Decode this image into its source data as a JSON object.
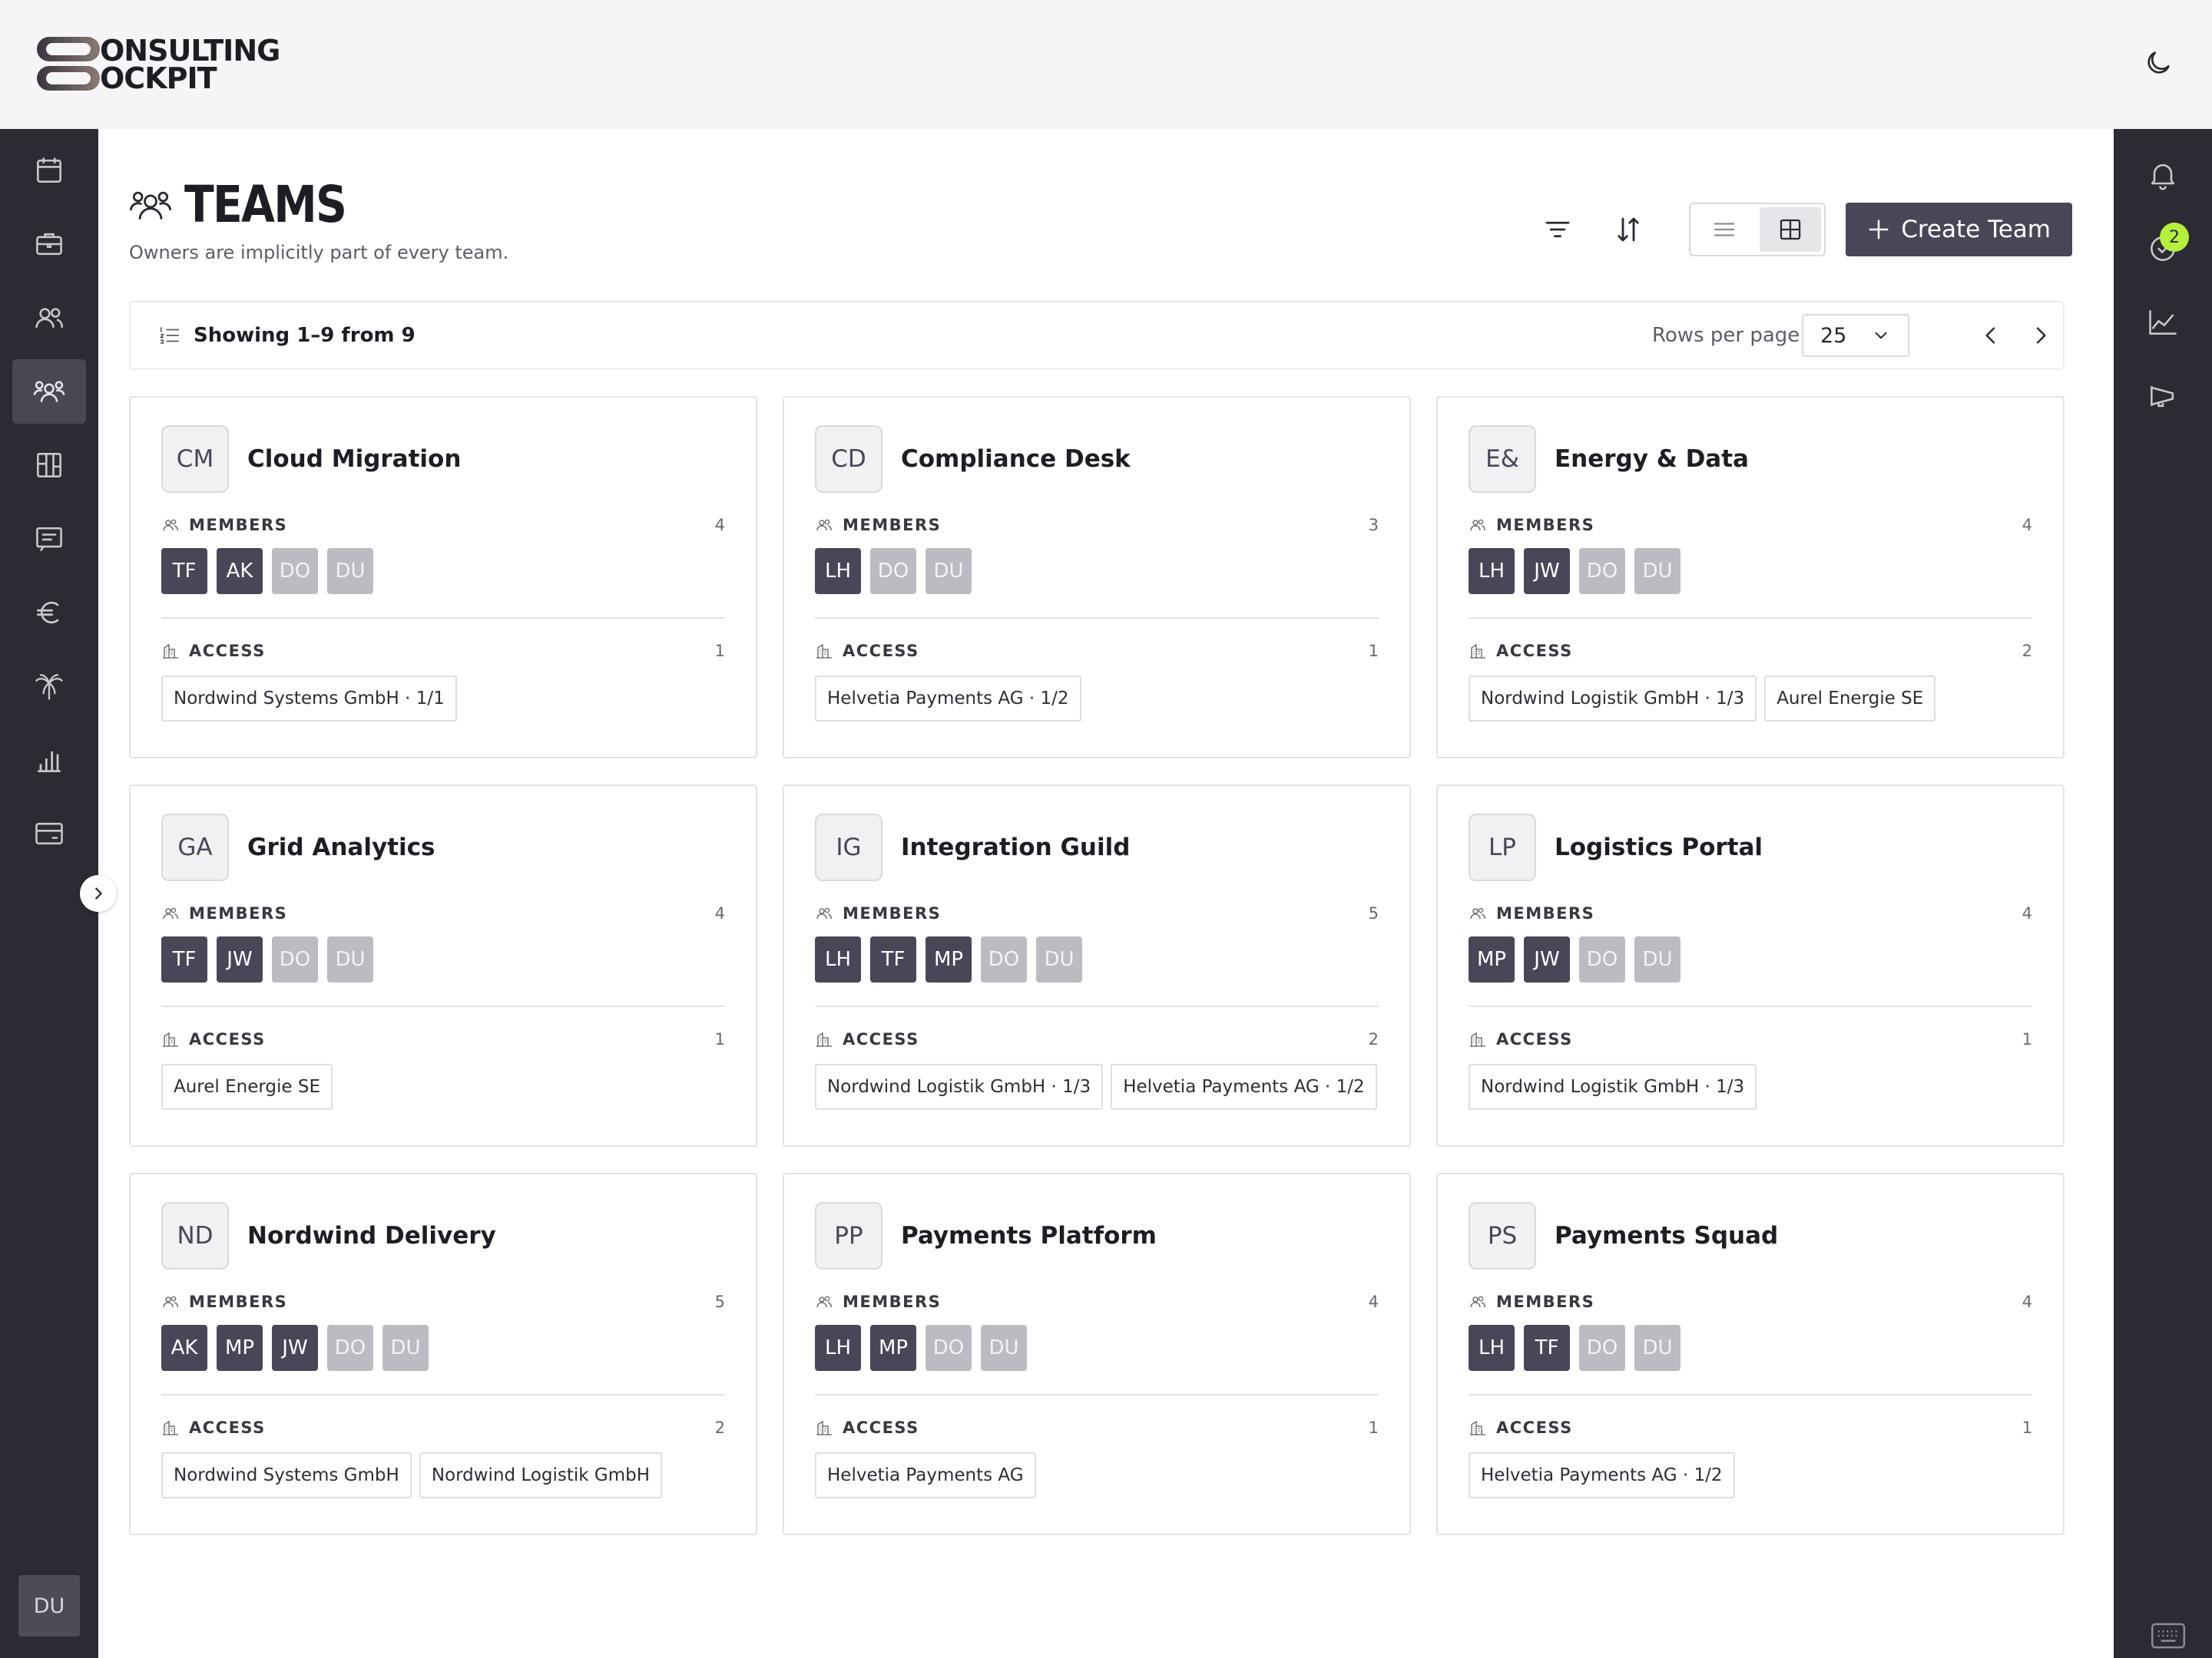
{
  "app": {
    "logo_text_line1": "ONSULTING",
    "logo_text_line2": "OCKPIT"
  },
  "page": {
    "title": "TEAMS",
    "subtitle": "Owners are implicitly part of every team."
  },
  "toolbar": {
    "create_label": "Create Team"
  },
  "pager": {
    "showing": "Showing 1–9 from 9",
    "rows_label": "Rows per page",
    "rows_value": "25"
  },
  "sidebar": {
    "items": [
      {
        "icon": "calendar-icon"
      },
      {
        "icon": "briefcase-icon"
      },
      {
        "icon": "people-icon"
      },
      {
        "icon": "teams-icon",
        "active": true
      },
      {
        "icon": "board-icon"
      },
      {
        "icon": "message-icon"
      },
      {
        "icon": "euro-icon"
      },
      {
        "icon": "palm-icon"
      },
      {
        "icon": "bar-chart-icon"
      },
      {
        "icon": "credit-card-icon"
      }
    ],
    "user_initials": "DU"
  },
  "right_sidebar": {
    "notification_badge": "2"
  },
  "labels": {
    "members": "MEMBERS",
    "access": "ACCESS"
  },
  "colors": {
    "sidebar_bg": "#2c2a32",
    "accent": "#4a4658",
    "badge": "#b4f03c"
  },
  "teams": [
    {
      "initials": "CM",
      "name": "Cloud Migration",
      "member_count": "4",
      "members": [
        {
          "i": "TF",
          "m": false
        },
        {
          "i": "AK",
          "m": false
        },
        {
          "i": "DO",
          "m": true
        },
        {
          "i": "DU",
          "m": true
        }
      ],
      "access_count": "1",
      "access": [
        "Nordwind Systems GmbH · 1/1"
      ]
    },
    {
      "initials": "CD",
      "name": "Compliance Desk",
      "member_count": "3",
      "members": [
        {
          "i": "LH",
          "m": false
        },
        {
          "i": "DO",
          "m": true
        },
        {
          "i": "DU",
          "m": true
        }
      ],
      "access_count": "1",
      "access": [
        "Helvetia Payments AG · 1/2"
      ]
    },
    {
      "initials": "E&",
      "name": "Energy & Data",
      "member_count": "4",
      "members": [
        {
          "i": "LH",
          "m": false
        },
        {
          "i": "JW",
          "m": false
        },
        {
          "i": "DO",
          "m": true
        },
        {
          "i": "DU",
          "m": true
        }
      ],
      "access_count": "2",
      "access": [
        "Nordwind Logistik GmbH · 1/3",
        "Aurel Energie SE"
      ]
    },
    {
      "initials": "GA",
      "name": "Grid Analytics",
      "member_count": "4",
      "members": [
        {
          "i": "TF",
          "m": false
        },
        {
          "i": "JW",
          "m": false
        },
        {
          "i": "DO",
          "m": true
        },
        {
          "i": "DU",
          "m": true
        }
      ],
      "access_count": "1",
      "access": [
        "Aurel Energie SE"
      ]
    },
    {
      "initials": "IG",
      "name": "Integration Guild",
      "member_count": "5",
      "members": [
        {
          "i": "LH",
          "m": false
        },
        {
          "i": "TF",
          "m": false
        },
        {
          "i": "MP",
          "m": false
        },
        {
          "i": "DO",
          "m": true
        },
        {
          "i": "DU",
          "m": true
        }
      ],
      "access_count": "2",
      "access": [
        "Nordwind Logistik GmbH · 1/3",
        "Helvetia Payments AG · 1/2"
      ]
    },
    {
      "initials": "LP",
      "name": "Logistics Portal",
      "member_count": "4",
      "members": [
        {
          "i": "MP",
          "m": false
        },
        {
          "i": "JW",
          "m": false
        },
        {
          "i": "DO",
          "m": true
        },
        {
          "i": "DU",
          "m": true
        }
      ],
      "access_count": "1",
      "access": [
        "Nordwind Logistik GmbH · 1/3"
      ]
    },
    {
      "initials": "ND",
      "name": "Nordwind Delivery",
      "member_count": "5",
      "members": [
        {
          "i": "AK",
          "m": false
        },
        {
          "i": "MP",
          "m": false
        },
        {
          "i": "JW",
          "m": false
        },
        {
          "i": "DO",
          "m": true
        },
        {
          "i": "DU",
          "m": true
        }
      ],
      "access_count": "2",
      "access": [
        "Nordwind Systems GmbH",
        "Nordwind Logistik GmbH"
      ]
    },
    {
      "initials": "PP",
      "name": "Payments Platform",
      "member_count": "4",
      "members": [
        {
          "i": "LH",
          "m": false
        },
        {
          "i": "MP",
          "m": false
        },
        {
          "i": "DO",
          "m": true
        },
        {
          "i": "DU",
          "m": true
        }
      ],
      "access_count": "1",
      "access": [
        "Helvetia Payments AG"
      ]
    },
    {
      "initials": "PS",
      "name": "Payments Squad",
      "member_count": "4",
      "members": [
        {
          "i": "LH",
          "m": false
        },
        {
          "i": "TF",
          "m": false
        },
        {
          "i": "DO",
          "m": true
        },
        {
          "i": "DU",
          "m": true
        }
      ],
      "access_count": "1",
      "access": [
        "Helvetia Payments AG · 1/2"
      ]
    }
  ]
}
